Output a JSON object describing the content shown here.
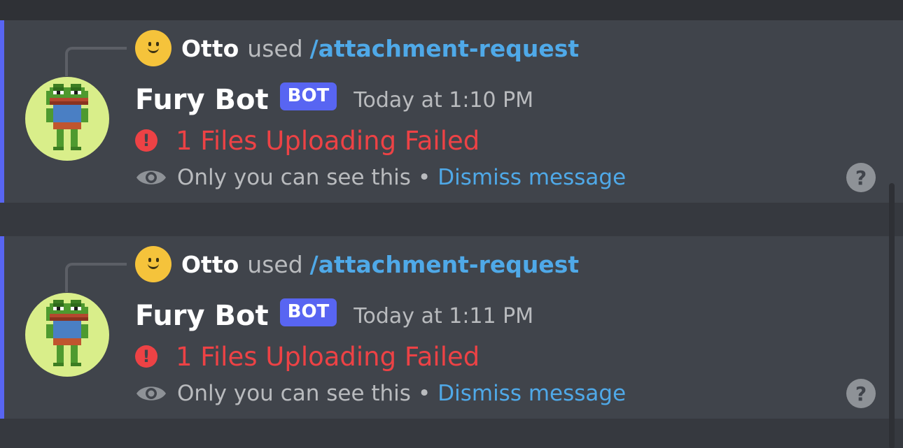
{
  "colors": {
    "background": "#36393f",
    "message_bg": "#40444b",
    "accent": "#5865f2",
    "link": "#4fa9e8",
    "error": "#ed4245",
    "muted_text": "#b9bbbe"
  },
  "messages": [
    {
      "reference": {
        "avatar_icon": "smiley-face-icon",
        "username": "Otto",
        "used_text": "used",
        "command": "/attachment-request"
      },
      "author": {
        "name": "Fury Bot",
        "avatar_icon": "pixel-frog-avatar-icon",
        "tag": "BOT"
      },
      "timestamp": "Today at 1:10 PM",
      "error_icon": "!",
      "error_text": "1 Files Uploading Failed",
      "ephemeral_notice": "Only you can see this",
      "separator": "•",
      "dismiss_label": "Dismiss message",
      "help_icon": "?"
    },
    {
      "reference": {
        "avatar_icon": "smiley-face-icon",
        "username": "Otto",
        "used_text": "used",
        "command": "/attachment-request"
      },
      "author": {
        "name": "Fury Bot",
        "avatar_icon": "pixel-frog-avatar-icon",
        "tag": "BOT"
      },
      "timestamp": "Today at 1:11 PM",
      "error_icon": "!",
      "error_text": "1 Files Uploading Failed",
      "ephemeral_notice": "Only you can see this",
      "separator": "•",
      "dismiss_label": "Dismiss message",
      "help_icon": "?"
    }
  ]
}
